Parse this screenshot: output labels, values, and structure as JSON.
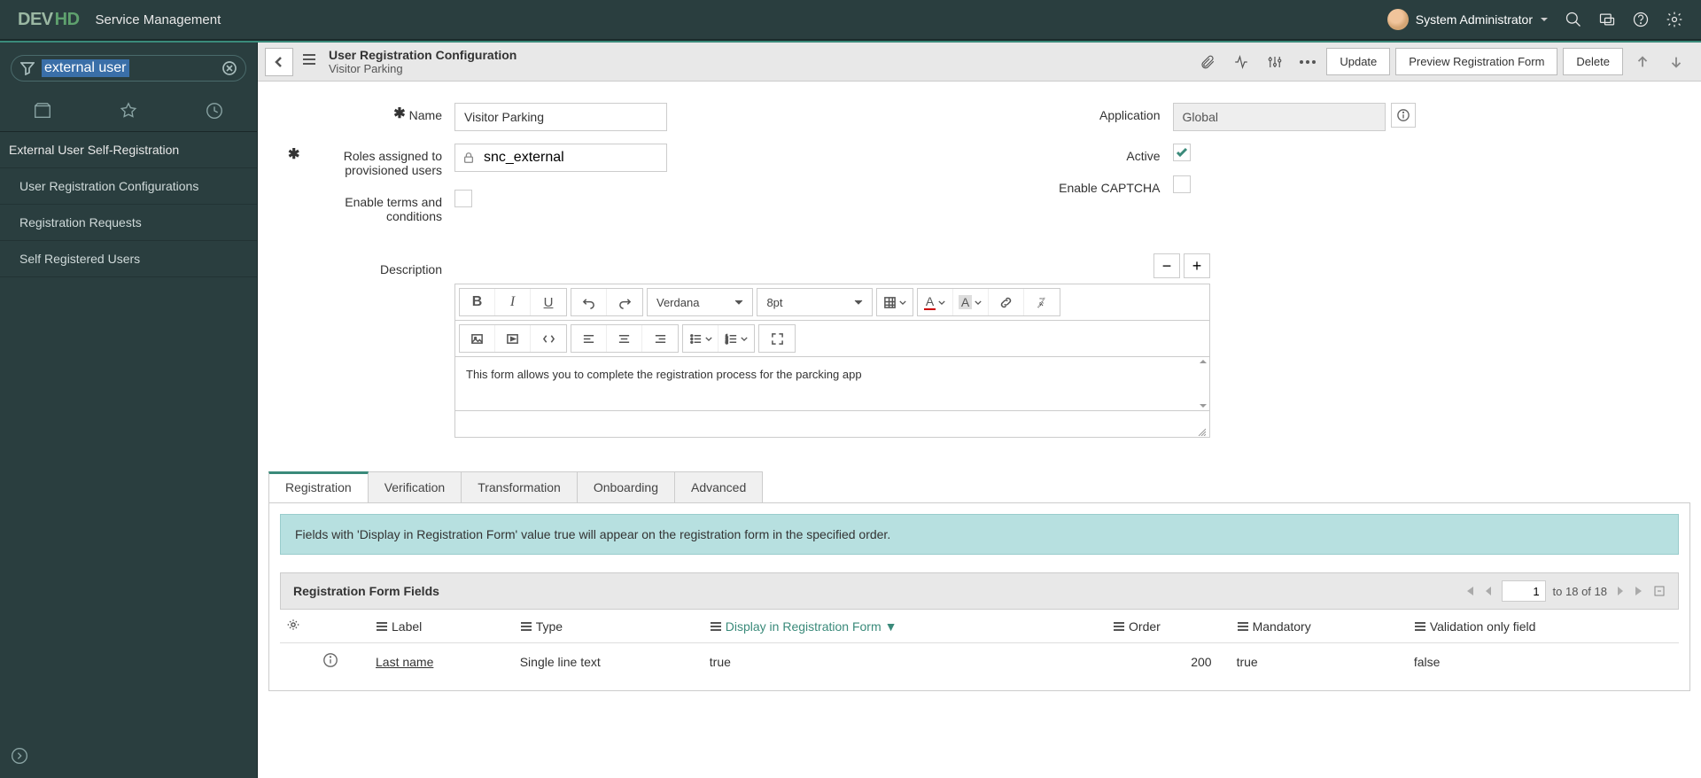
{
  "topbar": {
    "logo_part1": "DEV",
    "logo_part2": "HD",
    "app_title": "Service Management",
    "user_name": "System Administrator"
  },
  "sidebar": {
    "search_value": "external user",
    "section_header": "External User Self-Registration",
    "items": [
      "User Registration Configurations",
      "Registration Requests",
      "Self Registered Users"
    ]
  },
  "form_header": {
    "title": "User Registration Configuration",
    "subtitle": "Visitor Parking",
    "buttons": {
      "update": "Update",
      "preview": "Preview Registration Form",
      "delete": "Delete"
    }
  },
  "form": {
    "labels": {
      "name": "Name",
      "roles": "Roles assigned to provisioned users",
      "terms": "Enable terms and conditions",
      "application": "Application",
      "active": "Active",
      "captcha": "Enable CAPTCHA",
      "description": "Description"
    },
    "values": {
      "name": "Visitor Parking",
      "roles": "snc_external",
      "application": "Global",
      "description": "This form allows you to complete the registration process for the parcking app"
    },
    "rte": {
      "font": "Verdana",
      "size": "8pt"
    }
  },
  "tabs": {
    "list": [
      "Registration",
      "Verification",
      "Transformation",
      "Onboarding",
      "Advanced"
    ],
    "info_banner": "Fields with 'Display in Registration Form' value true will appear on the registration form in the specified order.",
    "list_title": "Registration Form Fields",
    "pager": {
      "current": "1",
      "range": "to 18 of 18"
    },
    "columns": {
      "label": "Label",
      "type": "Type",
      "display": "Display in Registration Form",
      "order": "Order",
      "mandatory": "Mandatory",
      "validation": "Validation only field"
    },
    "row": {
      "label": "Last name",
      "type": "Single line text",
      "display": "true",
      "order": "200",
      "mandatory": "true",
      "validation": "false"
    }
  }
}
